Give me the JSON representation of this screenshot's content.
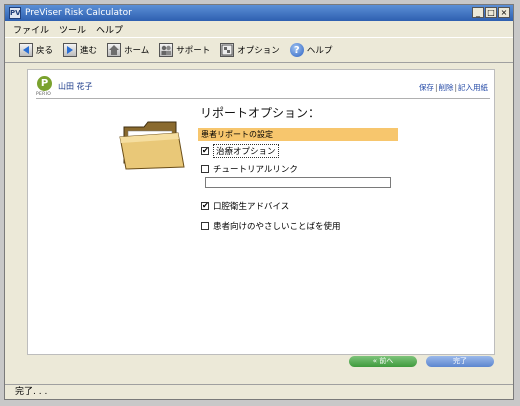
{
  "window": {
    "title": "PreViser Risk Calculator",
    "app_icon_text": "PV"
  },
  "winbtns": {
    "minimize": "_",
    "maximize": "□",
    "close": "×"
  },
  "menu": [
    "ファイル",
    "ツール",
    "ヘルプ"
  ],
  "toolbar": {
    "back": "戻る",
    "forward": "進む",
    "home": "ホーム",
    "support": "サポート",
    "options": "オプション",
    "help": "ヘルプ"
  },
  "panel": {
    "logo_letter": "P",
    "logo_text": "PERIO",
    "patient_name": "山田 花子",
    "links": [
      "保存",
      "削除",
      "記入用紙"
    ]
  },
  "report": {
    "title": "リポートオプション：",
    "section": "患者リポートの設定",
    "options": [
      {
        "label": "治療オプション",
        "checked": true
      },
      {
        "label": "チュートリアルリンク",
        "checked": false
      },
      {
        "label": "口腔衛生アドバイス",
        "checked": true
      },
      {
        "label": "患者向けのやさしいことばを使用",
        "checked": false
      }
    ],
    "tutorial_url": ""
  },
  "buttons": {
    "prev": "« 前へ",
    "done": "完了"
  },
  "status": "完了. . ."
}
